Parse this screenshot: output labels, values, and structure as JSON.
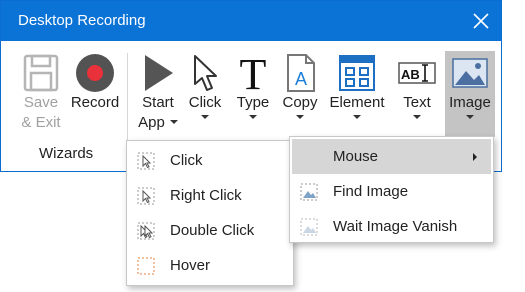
{
  "window": {
    "title": "Desktop Recording"
  },
  "ribbon": {
    "save_exit": "Save\n& Exit",
    "save_line1": "Save",
    "save_line2": "& Exit",
    "record": "Record",
    "start_app_line1": "Start",
    "start_app_line2": "App",
    "click": "Click",
    "type": "Type",
    "copy": "Copy",
    "element": "Element",
    "text": "Text",
    "image": "Image",
    "group_label": "Wizards"
  },
  "click_menu": {
    "items": [
      {
        "label": "Click",
        "icon": "click-icon"
      },
      {
        "label": "Right Click",
        "icon": "right-click-icon"
      },
      {
        "label": "Double Click",
        "icon": "double-click-icon"
      },
      {
        "label": "Hover",
        "icon": "hover-icon"
      }
    ]
  },
  "image_menu": {
    "items": [
      {
        "label": "Mouse",
        "submenu": true,
        "highlighted": true
      },
      {
        "label": "Find Image",
        "icon": "find-image-icon"
      },
      {
        "label": "Wait Image Vanish",
        "icon": "wait-image-vanish-icon"
      }
    ]
  },
  "colors": {
    "titlebar": "#0b73d6",
    "record": "#e8313a",
    "highlight": "#d6d6d6",
    "active_button": "#c4c4c4"
  }
}
